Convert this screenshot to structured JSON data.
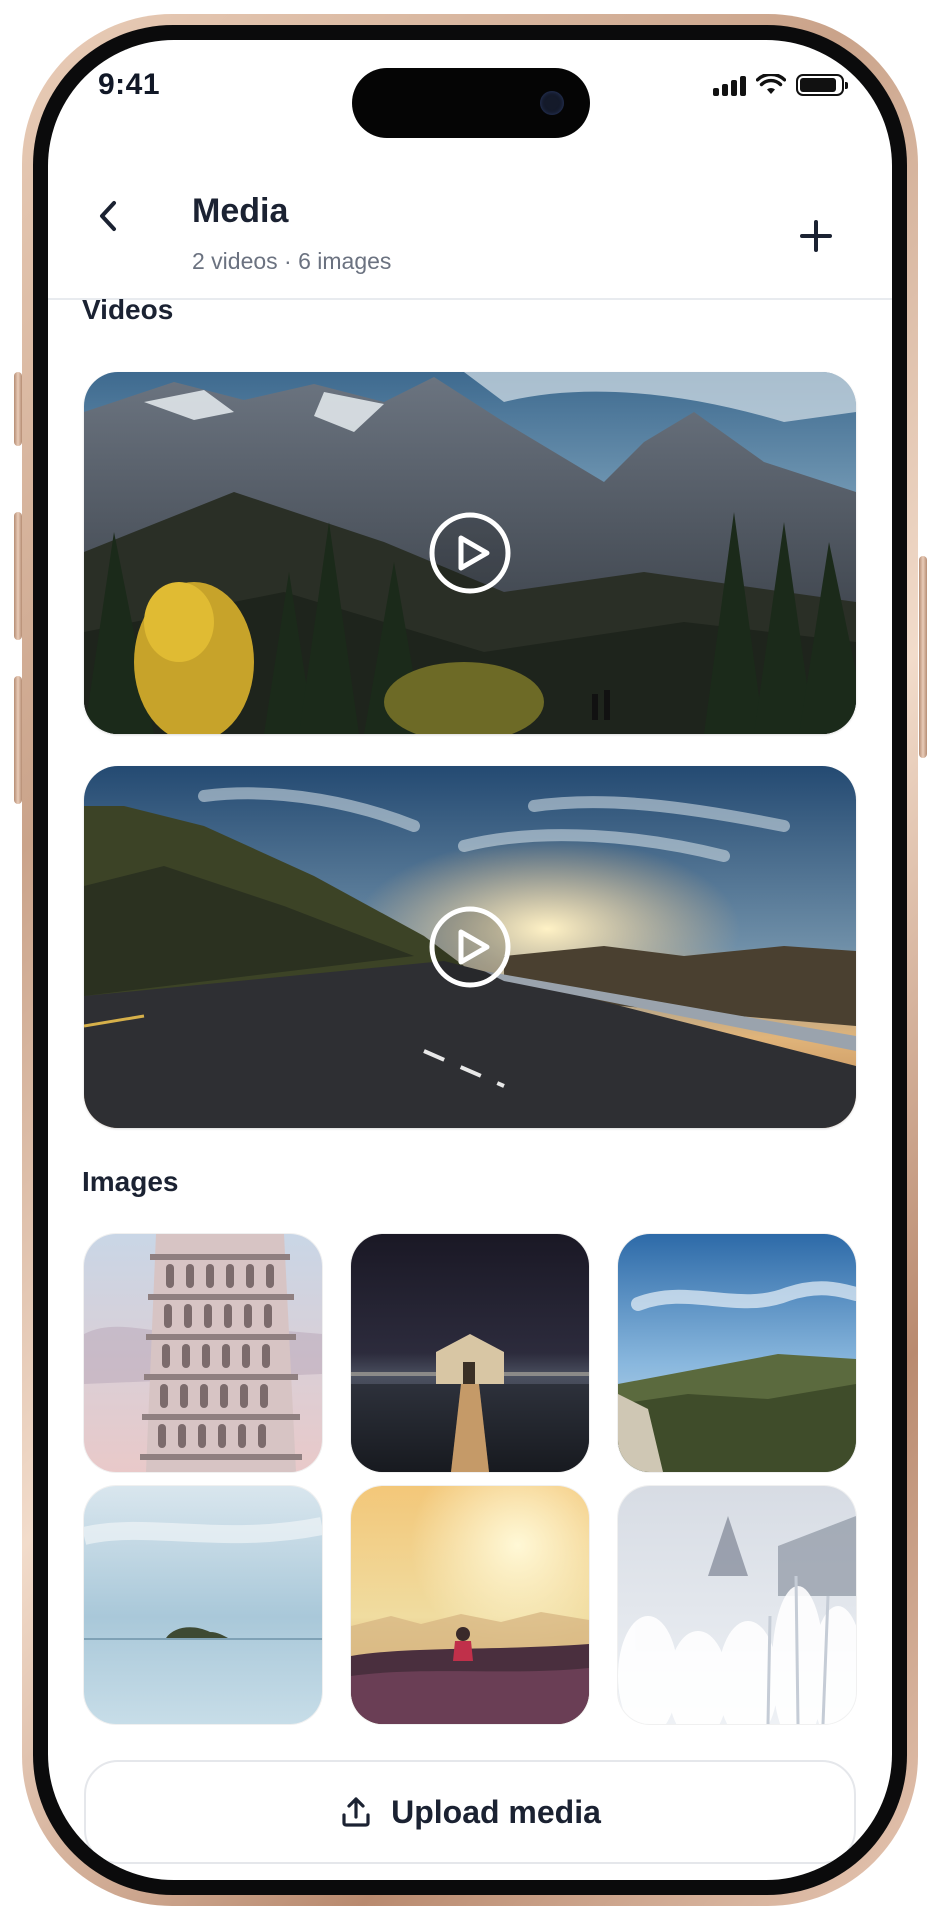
{
  "status_bar": {
    "time": "9:41"
  },
  "header": {
    "title": "Media",
    "subtitle": "2 videos · 6 images",
    "back_icon": "chevron-left-icon",
    "add_icon": "plus-icon"
  },
  "videos": {
    "section_title": "Videos",
    "items": [
      {
        "scene": "mountain-forest",
        "play_icon": "play-icon"
      },
      {
        "scene": "road-sunset",
        "play_icon": "play-icon"
      }
    ]
  },
  "images": {
    "section_title": "Images",
    "items": [
      {
        "scene": "leaning-tower"
      },
      {
        "scene": "boathouse-night"
      },
      {
        "scene": "coastal-hills"
      },
      {
        "scene": "calm-sea-island"
      },
      {
        "scene": "golden-field-sunrise"
      },
      {
        "scene": "frosted-grass"
      }
    ]
  },
  "upload": {
    "label": "Upload media",
    "icon": "upload-icon"
  },
  "colors": {
    "text_primary": "#1b2232",
    "text_secondary": "#6b7280",
    "divider": "#e8ebef"
  }
}
